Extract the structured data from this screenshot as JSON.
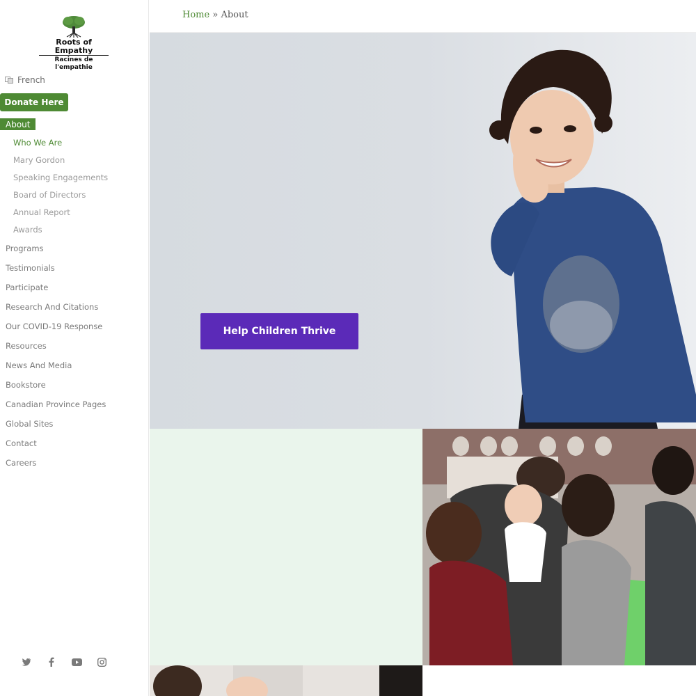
{
  "logo": {
    "name_en": "Roots of Empathy",
    "name_fr": "Racines de l'empathie"
  },
  "language": {
    "label": "French",
    "icon": "translate-icon"
  },
  "donate": {
    "label": "Donate Here"
  },
  "nav": {
    "active": "About",
    "sub_items": [
      "Who We Are",
      "Mary Gordon",
      "Speaking Engagements",
      "Board of Directors",
      "Annual Report",
      "Awards"
    ],
    "items": [
      "Programs",
      "Testimonials",
      "Participate",
      "Research And Citations",
      "Our COVID-19 Response",
      "Resources",
      "News And Media",
      "Bookstore",
      "Canadian Province Pages",
      "Global Sites",
      "Contact",
      "Careers"
    ]
  },
  "social": [
    "twitter-icon",
    "facebook-icon",
    "youtube-icon",
    "instagram-icon"
  ],
  "breadcrumb": {
    "home": "Home",
    "separator": "»",
    "current": "About"
  },
  "hero": {
    "cta_label": "Help Children Thrive"
  },
  "colors": {
    "brand_green": "#4e8a34",
    "cta_purple": "#5b2ab8",
    "panel_green": "#eaf5ec"
  }
}
